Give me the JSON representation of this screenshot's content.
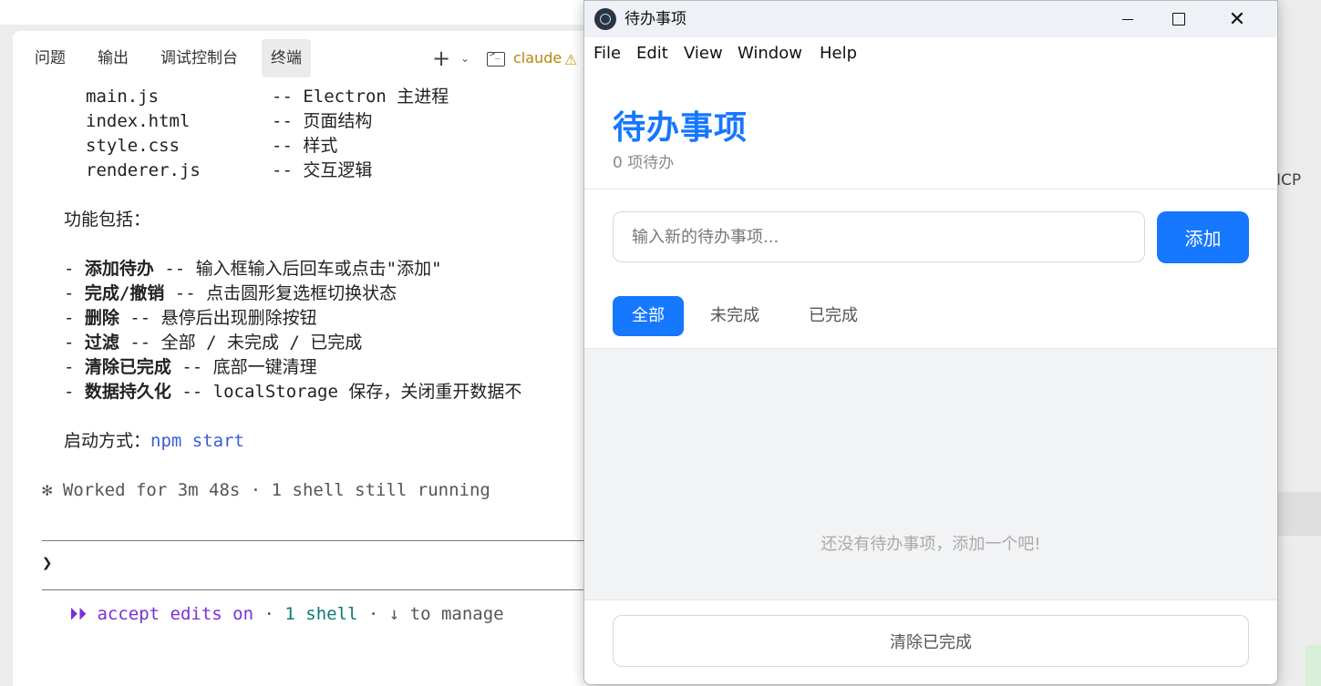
{
  "terminal_panel": {
    "tabs": [
      {
        "label": "问题"
      },
      {
        "label": "输出"
      },
      {
        "label": "调试控制台"
      },
      {
        "label": "终端"
      }
    ],
    "toolbar": {
      "plus": "+",
      "chevron": "⌄",
      "terminal_icon": "terminal-icon",
      "terminal_name": "claude",
      "warning_icon": "⚠"
    },
    "files": [
      {
        "name": "main.js",
        "desc": "-- Electron 主进程"
      },
      {
        "name": "index.html",
        "desc": "-- 页面结构"
      },
      {
        "name": "style.css",
        "desc": "-- 样式"
      },
      {
        "name": "renderer.js",
        "desc": "-- 交互逻辑"
      }
    ],
    "features_heading": "功能包括：",
    "features": [
      {
        "bullet": "- ",
        "title": "添加待办",
        "desc": " -- 输入框输入后回车或点击\"添加\""
      },
      {
        "bullet": "- ",
        "title": "完成/撤销",
        "desc": " -- 点击圆形复选框切换状态"
      },
      {
        "bullet": "- ",
        "title": "删除",
        "desc": " -- 悬停后出现删除按钮"
      },
      {
        "bullet": "- ",
        "title": "过滤",
        "desc": " -- 全部 / 未完成 / 已完成"
      },
      {
        "bullet": "- ",
        "title": "清除已完成",
        "desc": " -- 底部一键清理"
      },
      {
        "bullet": "- ",
        "title": "数据持久化",
        "desc": " -- localStorage 保存，关闭重开数据不"
      }
    ],
    "start_label": "启动方式：",
    "start_cmd": "npm start",
    "worked": "✻ Worked for 3m 48s · 1 shell still running",
    "prompt": "❯",
    "status": {
      "arrows": "⏵⏵",
      "accept": " accept edits on",
      "sep1": " · ",
      "shell": "1 shell",
      "sep2": " · ",
      "manage": "↓ to manage"
    },
    "right_text": "ICP"
  },
  "electron_window": {
    "title": "待办事项",
    "menu": [
      "File",
      "Edit",
      "View",
      "Window",
      "Help"
    ],
    "heading": "待办事项",
    "count_text": "0 项待办",
    "input_placeholder": "输入新的待办事项...",
    "add_label": "添加",
    "filters": [
      "全部",
      "未完成",
      "已完成"
    ],
    "active_filter": "全部",
    "empty_text": "还没有待办事项，添加一个吧!",
    "clear_label": "清除已完成",
    "accent_color": "#1677ff"
  }
}
